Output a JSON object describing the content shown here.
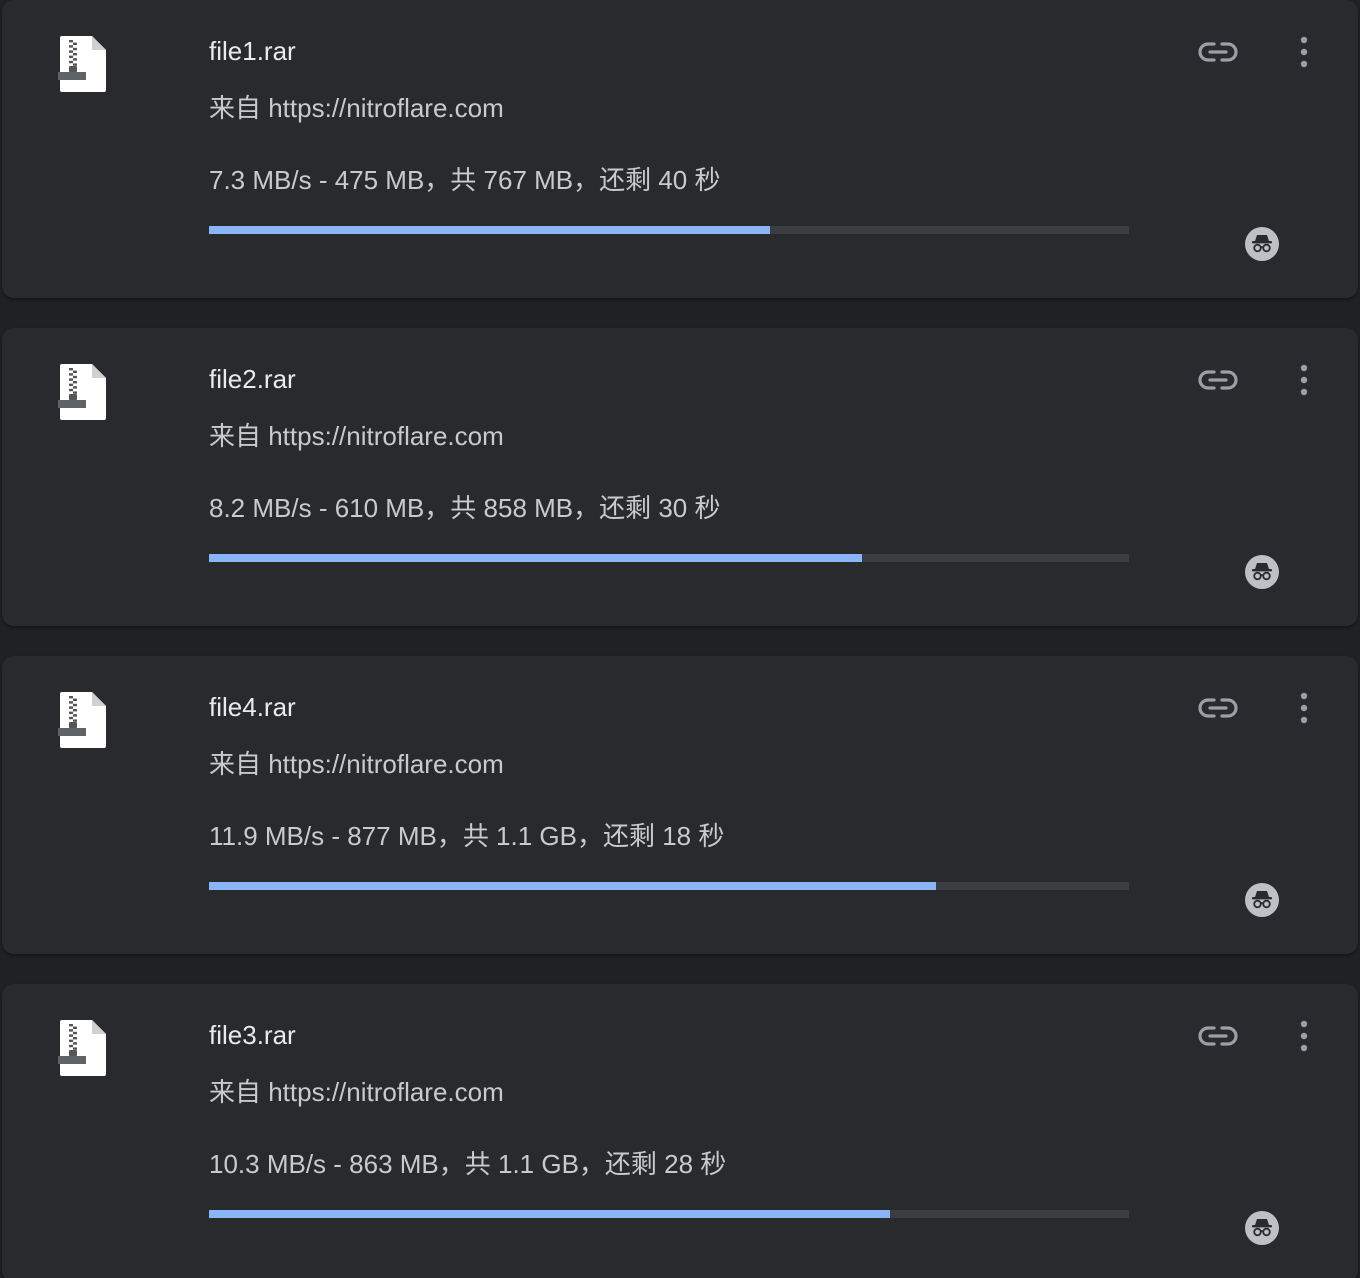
{
  "downloads": [
    {
      "name": "file1.rar",
      "source": "来自 https://nitroflare.com",
      "status": "7.3 MB/s - 475 MB，共 767 MB，还剩 40 秒",
      "progress": 0.61
    },
    {
      "name": "file2.rar",
      "source": "来自 https://nitroflare.com",
      "status": "8.2 MB/s - 610 MB，共 858 MB，还剩 30 秒",
      "progress": 0.71
    },
    {
      "name": "file4.rar",
      "source": "来自 https://nitroflare.com",
      "status": "11.9 MB/s - 877 MB，共 1.1 GB，还剩 18 秒",
      "progress": 0.79
    },
    {
      "name": "file3.rar",
      "source": "来自 https://nitroflare.com",
      "status": "10.3 MB/s - 863 MB，共 1.1 GB，还剩 28 秒",
      "progress": 0.74
    }
  ],
  "icons": {
    "file": "archive-file-icon",
    "link": "link-icon",
    "more": "more-vert-icon",
    "incognito": "incognito-icon"
  },
  "colors": {
    "background": "#202124",
    "card": "#292a2d",
    "progress_fill": "#8ab4f8",
    "progress_track": "#3c3d40",
    "text_primary": "#e8eaed",
    "text_secondary": "#c8cacd"
  }
}
